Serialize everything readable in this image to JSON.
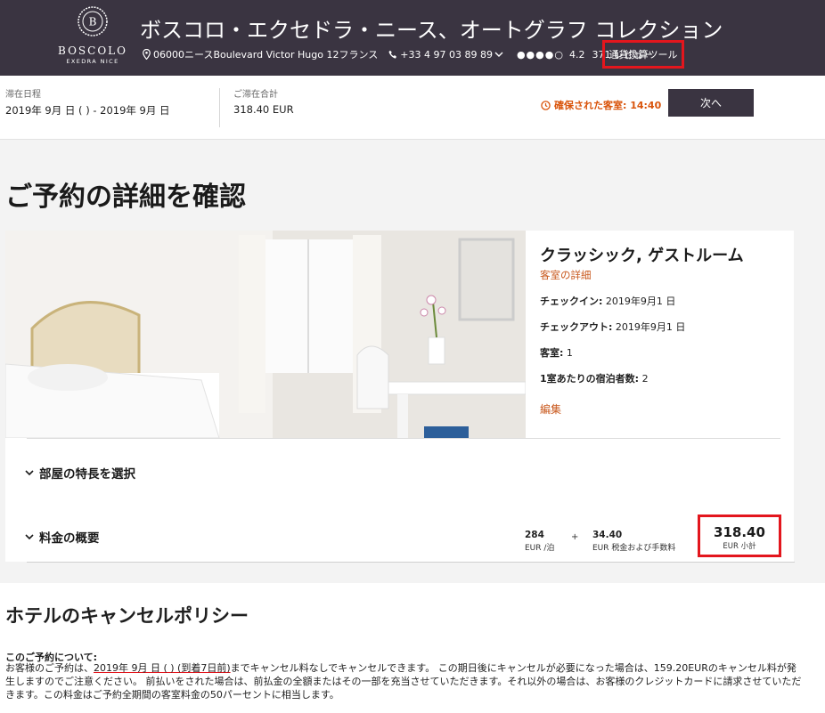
{
  "header": {
    "logo_brand": "BOSCOLO",
    "logo_sub": "EXEDRA NICE",
    "logo_letter": "B",
    "hotel_name": "ボスコロ・エクセドラ・ニース、オートグラフ コレクション",
    "address": "06000ニースBoulevard Victor Hugo 12フランス",
    "phone": "+33 4 97 03 89 89",
    "rating_dots": "●●●●○",
    "rating": "4.2",
    "reviews": "371 レビュー",
    "currency_tool": "通貨換算ツール"
  },
  "stay": {
    "dates_label": "滞在日程",
    "dates_value": "2019年 9月   日 (    ) - 2019年 9月    日",
    "total_label": "ご滞在合計",
    "total_value": "318.40 EUR",
    "confirmed_label": "確保された客室: 14:40",
    "next_button": "次へ"
  },
  "main": {
    "title": "ご予約の詳細を確認"
  },
  "room": {
    "title": "クラッシック, ゲストルーム",
    "details_link": "客室の詳細",
    "checkin_label": "チェックイン:",
    "checkin_value": "2019年9月1  日",
    "checkout_label": "チェックアウト:",
    "checkout_value": "2019年9月1  日",
    "rooms_label": "客室:",
    "rooms_value": "1",
    "guests_label": "1室あたりの宿泊者数:",
    "guests_value": "2",
    "edit_link": "編集"
  },
  "sections": {
    "features": "部屋の特長を選択",
    "price_summary": "料金の概要"
  },
  "price": {
    "nightly_value": "284",
    "nightly_unit": "EUR /泊",
    "plus": "+",
    "tax_value": "34.40",
    "tax_unit": "EUR 税金および手数料",
    "subtotal_value": "318.40",
    "subtotal_unit": "EUR 小計"
  },
  "cancel": {
    "title": "ホテルのキャンセルポリシー",
    "subtitle": "このご予約について:",
    "text_pre": "お客様のご予約は、",
    "text_date": "2019年 9月    日 (    ) (到着7日前)",
    "text_post": "までキャンセル料なしでキャンセルできます。 この期日後にキャンセルが必要になった場合は、159.20EURのキャンセル料が発生しますのでご注意ください。 前払いをされた場合は、前払金の全額またはその一部を充当させていただきます。それ以外の場合は、お客様のクレジットカードに請求させていただきます。この料金はご予約全期間の客室料金の50パーセントに相当します。"
  },
  "colors": {
    "header_bg": "#3a3441",
    "accent_orange": "#c8571b",
    "highlight_red": "#e3161d"
  }
}
